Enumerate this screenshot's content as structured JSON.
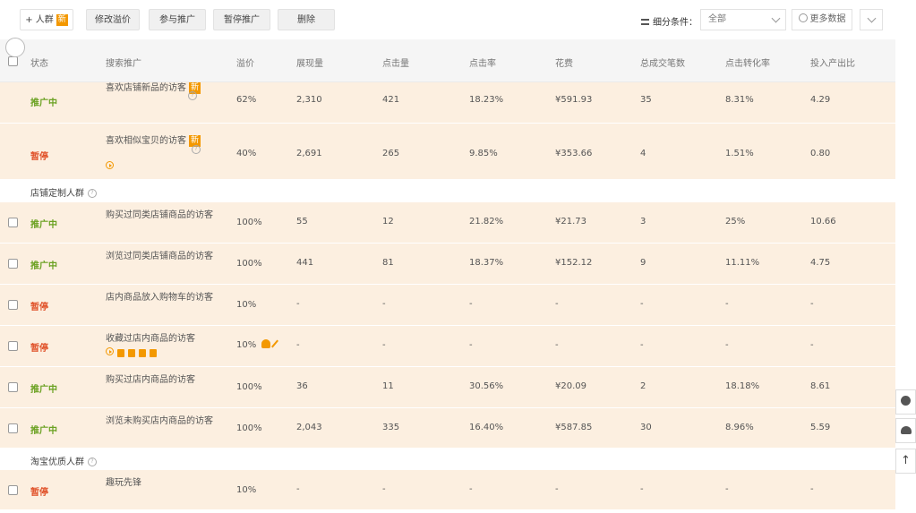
{
  "toolbar": {
    "add_crowd_label": "+ 人群",
    "add_crowd_badge": "新",
    "modify_premium_label": "修改溢价",
    "join_promo_label": "参与推广",
    "pause_promo_label": "暂停推广",
    "delete_label": "删除",
    "filter_label": "细分条件：",
    "filter_value": "全部",
    "more_data_label": "更多数据"
  },
  "columns": [
    "状态",
    "搜索推广",
    "溢价",
    "展现量",
    "点击量",
    "点击率",
    "花费",
    "总成交笔数",
    "点击转化率",
    "投入产出比"
  ],
  "rows_top": [
    {
      "status": "推广中",
      "status_type": "on",
      "name": "喜欢店铺新品的访客",
      "badge": "新",
      "premium": "62%",
      "impressions": "2,310",
      "clicks": "421",
      "ctr": "18.23%",
      "cost": "¥591.93",
      "orders": "35",
      "cvr": "8.31%",
      "roi": "4.29"
    },
    {
      "status": "暂停",
      "status_type": "off",
      "name": "喜欢相似宝贝的访客",
      "badge": "新",
      "premium": "40%",
      "impressions": "2,691",
      "clicks": "265",
      "ctr": "9.85%",
      "cost": "¥353.66",
      "orders": "4",
      "cvr": "1.51%",
      "roi": "0.80"
    }
  ],
  "group1": {
    "label": "店铺定制人群"
  },
  "rows_group1": [
    {
      "status": "推广中",
      "status_type": "on",
      "name": "购买过同类店铺商品的访客",
      "premium": "100%",
      "impressions": "55",
      "clicks": "12",
      "ctr": "21.82%",
      "cost": "¥21.73",
      "orders": "3",
      "cvr": "25%",
      "roi": "10.66"
    },
    {
      "status": "推广中",
      "status_type": "on",
      "name": "浏览过同类店铺商品的访客",
      "premium": "100%",
      "impressions": "441",
      "clicks": "81",
      "ctr": "18.37%",
      "cost": "¥152.12",
      "orders": "9",
      "cvr": "11.11%",
      "roi": "4.75"
    },
    {
      "status": "暂停",
      "status_type": "off",
      "name": "店内商品放入购物车的访客",
      "premium": "10%",
      "impressions": "-",
      "clicks": "-",
      "ctr": "-",
      "cost": "-",
      "orders": "-",
      "cvr": "-",
      "roi": "-"
    },
    {
      "status": "暂停",
      "status_type": "off",
      "name": "收藏过店内商品的访客",
      "premium": "10%",
      "impressions": "-",
      "clicks": "-",
      "ctr": "-",
      "cost": "-",
      "orders": "-",
      "cvr": "-",
      "roi": "-"
    },
    {
      "status": "推广中",
      "status_type": "on",
      "name": "购买过店内商品的访客",
      "premium": "100%",
      "impressions": "36",
      "clicks": "11",
      "ctr": "30.56%",
      "cost": "¥20.09",
      "orders": "2",
      "cvr": "18.18%",
      "roi": "8.61"
    },
    {
      "status": "推广中",
      "status_type": "on",
      "name": "浏览未购买店内商品的访客",
      "premium": "100%",
      "impressions": "2,043",
      "clicks": "335",
      "ctr": "16.40%",
      "cost": "¥587.85",
      "orders": "30",
      "cvr": "8.96%",
      "roi": "5.59"
    }
  ],
  "group2": {
    "label": "淘宝优质人群"
  },
  "rows_group2": [
    {
      "status": "暂停",
      "status_type": "off",
      "name": "趣玩先锋",
      "premium": "10%",
      "impressions": "-",
      "clicks": "-",
      "ctr": "-",
      "cost": "-",
      "orders": "-",
      "cvr": "-",
      "roi": "-"
    }
  ],
  "colors": {
    "accent": "#f39800",
    "row_bg": "#fcefe0",
    "status_on": "#6aa121",
    "status_off": "#e0522a"
  }
}
